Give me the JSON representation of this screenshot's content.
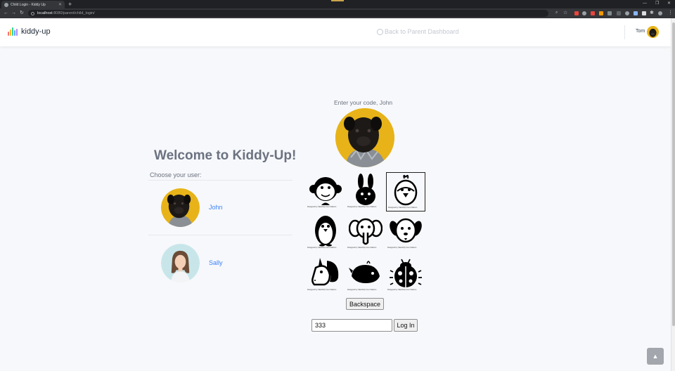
{
  "browser": {
    "tab_title": "Child Login - Kiddy Up",
    "url_host": "localhost",
    "url_path": ":8080/parent/child_login/"
  },
  "navbar": {
    "brand": "kiddy-up",
    "back_link": "Back to Parent Dashboard",
    "user_name": "Tom",
    "logo_colors": [
      "#f87171",
      "#fbbf24",
      "#34d399",
      "#60a5fa",
      "#a78bfa"
    ]
  },
  "left": {
    "welcome": "Welcome to Kiddy-Up!",
    "choose_label": "Choose your user:",
    "users": [
      {
        "name": "John",
        "avatar": "pug-icon"
      },
      {
        "name": "Sally",
        "avatar": "girl-portrait"
      }
    ]
  },
  "right": {
    "prompt": "Enter your code, John",
    "selected_index": 2,
    "animals": [
      "monkey-icon",
      "rabbit-icon",
      "chick-icon",
      "penguin-icon",
      "elephant-icon",
      "dog-icon",
      "unicorn-icon",
      "whale-icon",
      "ladybug-icon"
    ],
    "credit": "Designed by Sketchify from Flaticon",
    "backspace_label": "Backspace",
    "code_value": "333",
    "login_label": "Log In"
  },
  "colors": {
    "accent": "#3b82f6",
    "avatar_yellow": "#e7b318"
  }
}
